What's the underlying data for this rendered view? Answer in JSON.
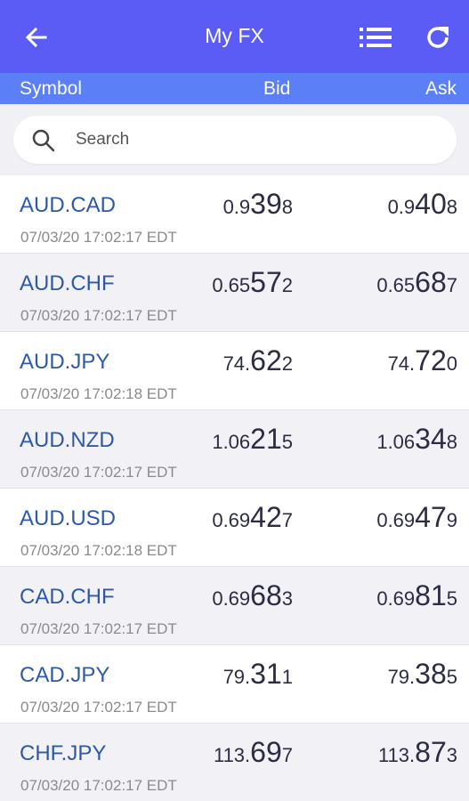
{
  "header": {
    "title": "My FX",
    "back_icon": "arrow-left-icon",
    "list_icon": "list-icon",
    "refresh_icon": "refresh-icon"
  },
  "columns": {
    "symbol": "Symbol",
    "bid": "Bid",
    "ask": "Ask"
  },
  "search": {
    "placeholder": "Search",
    "icon": "search-icon"
  },
  "colors": {
    "appbar": "#5b5cf5",
    "column_header": "#5a7ff6",
    "symbol_text": "#2c5aa8",
    "timestamp_text": "#8a8a8f"
  },
  "rows": [
    {
      "symbol": "AUD.CAD",
      "timestamp": "07/03/20 17:02:17 EDT",
      "bid": {
        "pre": "0.9",
        "big": "39",
        "post": "8"
      },
      "ask": {
        "pre": "0.9",
        "big": "40",
        "post": "8"
      }
    },
    {
      "symbol": "AUD.CHF",
      "timestamp": "07/03/20 17:02:17 EDT",
      "bid": {
        "pre": "0.65",
        "big": "57",
        "post": "2"
      },
      "ask": {
        "pre": "0.65",
        "big": "68",
        "post": "7"
      }
    },
    {
      "symbol": "AUD.JPY",
      "timestamp": "07/03/20 17:02:18 EDT",
      "bid": {
        "pre": "74.",
        "big": "62",
        "post": "2"
      },
      "ask": {
        "pre": "74.",
        "big": "72",
        "post": "0"
      }
    },
    {
      "symbol": "AUD.NZD",
      "timestamp": "07/03/20 17:02:17 EDT",
      "bid": {
        "pre": "1.06",
        "big": "21",
        "post": "5"
      },
      "ask": {
        "pre": "1.06",
        "big": "34",
        "post": "8"
      }
    },
    {
      "symbol": "AUD.USD",
      "timestamp": "07/03/20 17:02:18 EDT",
      "bid": {
        "pre": "0.69",
        "big": "42",
        "post": "7"
      },
      "ask": {
        "pre": "0.69",
        "big": "47",
        "post": "9"
      }
    },
    {
      "symbol": "CAD.CHF",
      "timestamp": "07/03/20 17:02:17 EDT",
      "bid": {
        "pre": "0.69",
        "big": "68",
        "post": "3"
      },
      "ask": {
        "pre": "0.69",
        "big": "81",
        "post": "5"
      }
    },
    {
      "symbol": "CAD.JPY",
      "timestamp": "07/03/20 17:02:17 EDT",
      "bid": {
        "pre": "79.",
        "big": "31",
        "post": "1"
      },
      "ask": {
        "pre": "79.",
        "big": "38",
        "post": "5"
      }
    },
    {
      "symbol": "CHF.JPY",
      "timestamp": "07/03/20 17:02:17 EDT",
      "bid": {
        "pre": "113.",
        "big": "69",
        "post": "7"
      },
      "ask": {
        "pre": "113.",
        "big": "87",
        "post": "3"
      }
    }
  ]
}
